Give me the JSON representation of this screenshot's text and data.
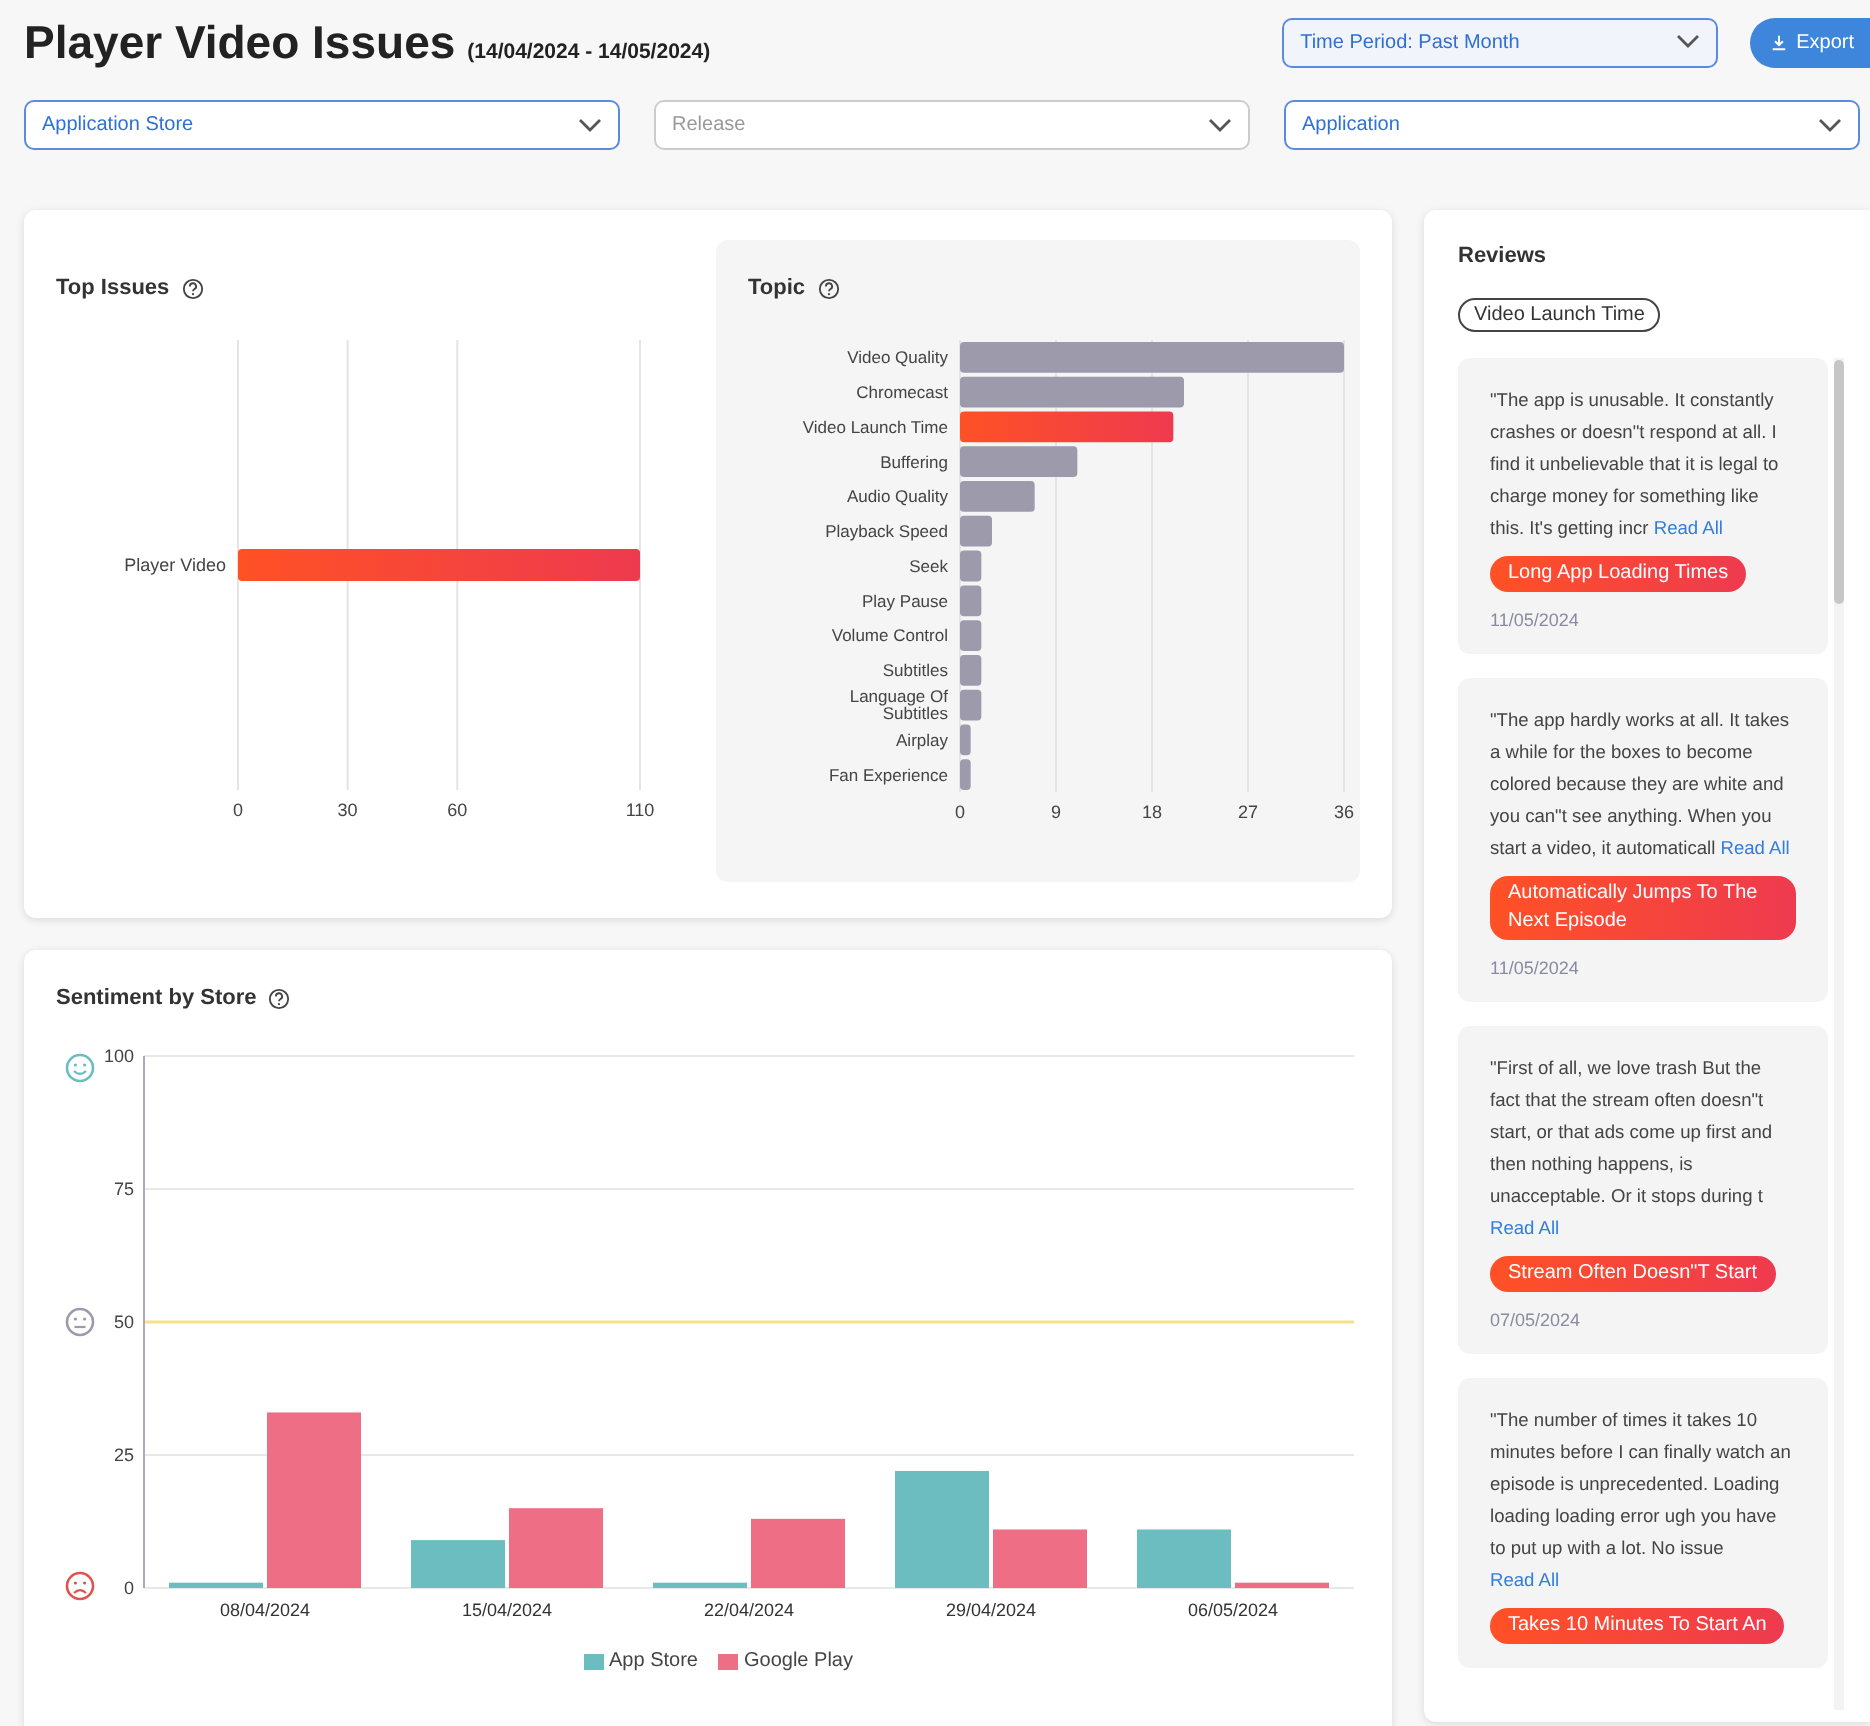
{
  "header": {
    "title": "Player Video Issues",
    "date_range": "(14/04/2024 - 14/05/2024)",
    "time_period": {
      "value": "Time Period: Past Month"
    },
    "export_button": {
      "label": "Export"
    }
  },
  "filters": [
    {
      "value": "Application Store"
    },
    {
      "placeholder": "Release"
    },
    {
      "value": "Application"
    }
  ],
  "top_issues": {
    "title": "Top Issues",
    "bars": [
      {
        "highlighted": true
      }
    ],
    "chart_data": {
      "type": "bar",
      "orientation": "horizontal",
      "grid": true,
      "categories": [
        "Player Video"
      ],
      "values": [
        110
      ],
      "xlim": [
        0,
        110
      ],
      "xticks": [
        0,
        30,
        60,
        110
      ]
    }
  },
  "topic": {
    "title": "Topic",
    "bars": [
      {
        "highlighted": false
      },
      {
        "highlighted": false
      },
      {
        "highlighted": true
      },
      {
        "highlighted": false
      },
      {
        "highlighted": false
      },
      {
        "highlighted": false
      },
      {
        "highlighted": false
      },
      {
        "highlighted": false
      },
      {
        "highlighted": false
      },
      {
        "highlighted": false
      },
      {
        "highlighted": false
      },
      {
        "highlighted": false
      },
      {
        "highlighted": false
      }
    ],
    "chart_data": {
      "type": "bar",
      "orientation": "horizontal",
      "grid": true,
      "categories": [
        "Video Quality",
        "Chromecast",
        "Video Launch Time",
        "Buffering",
        "Audio Quality",
        "Playback Speed",
        "Seek",
        "Play Pause",
        "Volume Control",
        "Subtitles",
        "Language Of Subtitles",
        "Airplay",
        "Fan Experience"
      ],
      "values": [
        36,
        21,
        20,
        11,
        7,
        3,
        2,
        2,
        2,
        2,
        2,
        1,
        1
      ],
      "xlim": [
        0,
        36
      ],
      "xticks": [
        0,
        9,
        18,
        27,
        36
      ]
    }
  },
  "sentiment": {
    "title": "Sentiment by Store",
    "chart_data": {
      "type": "bar",
      "categories": [
        "08/04/2024",
        "15/04/2024",
        "22/04/2024",
        "29/04/2024",
        "06/05/2024"
      ],
      "series": [
        {
          "name": "App Store",
          "color": "#6cbdbf",
          "values": [
            1,
            9,
            1,
            22,
            11
          ]
        },
        {
          "name": "Google Play",
          "color": "#ee6e85",
          "values": [
            33,
            15,
            13,
            11,
            1
          ]
        }
      ],
      "ylim": [
        0,
        100
      ],
      "yticks": [
        0,
        25,
        50,
        75,
        100
      ],
      "grid": true,
      "ref_lines": [
        {
          "axis": "y",
          "value": 50
        }
      ]
    }
  },
  "reviews": {
    "title": "Reviews",
    "filter_chip": "Video Launch Time",
    "items": [
      {
        "text": "\"The app is unusable. It constantly crashes or doesn\"t respond at all. I find it unbelievable that it is legal to charge money for something like this. It's getting incr",
        "link": "Read All",
        "tag": "Long App Loading Times",
        "date": "11/05/2024"
      },
      {
        "text": "\"The app hardly works at all. It takes a while for the boxes to become colored because they are white and you can\"t see anything. When you start a video, it automaticall",
        "link": "Read All",
        "tag": "Automatically Jumps To The Next Episode",
        "date": "11/05/2024"
      },
      {
        "text": "\"First of all, we love trash But the fact that the stream often doesn\"t start, or that ads come up first and then nothing happens, is unacceptable. Or it stops during t",
        "link": "Read All",
        "tag": "Stream Often Doesn\"T Start",
        "date": "07/05/2024"
      },
      {
        "text": "\"The number of times it takes 10 minutes before I can finally watch an episode is unprecedented. Loading loading loading error ugh you have to put up with a lot. No issue",
        "link": "Read All",
        "tag": "Takes 10 Minutes To Start An"
      }
    ]
  }
}
